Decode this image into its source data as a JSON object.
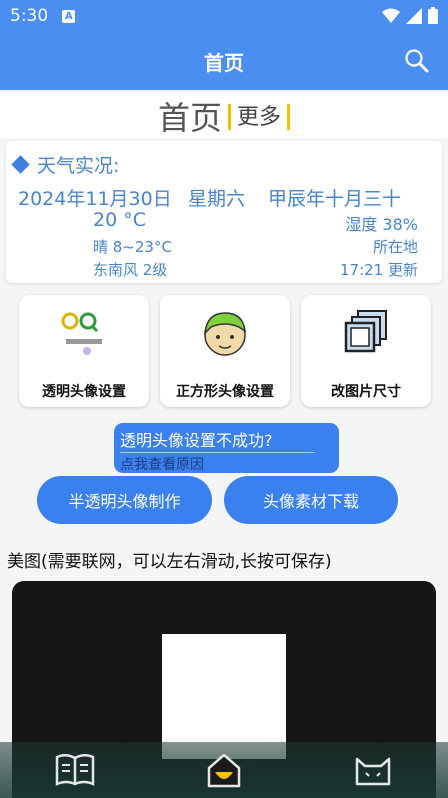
{
  "status_bar": {
    "time": "5:30",
    "app_badge": "A"
  },
  "app_bar": {
    "title": "首页",
    "search_icon": "search-icon"
  },
  "tabs": {
    "home": "首页",
    "more": "更多"
  },
  "weather": {
    "title": "天气实况:",
    "date": "2024年11月30日",
    "weekday": "星期六",
    "lunar": "甲辰年十月三十",
    "temperature": "20 °C",
    "humidity": "湿度 38%",
    "condition": "晴 8~23°C",
    "location": "所在地",
    "wind": "东南风 2级",
    "updated": "17:21 更新"
  },
  "tools": [
    {
      "label": "透明头像设置",
      "icon": "qq-transparent-avatar-icon"
    },
    {
      "label": "正方形头像设置",
      "icon": "square-avatar-icon"
    },
    {
      "label": "改图片尺寸",
      "icon": "resize-image-icon"
    }
  ],
  "help": {
    "question": "透明头像设置不成功?",
    "link": "点我查看原因"
  },
  "buttons": {
    "translucent": "半透明头像制作",
    "materials": "头像素材下载"
  },
  "gallery": {
    "caption": "美图(需要联网，可以左右滑动,长按可保存)"
  },
  "nav": [
    {
      "icon": "book-icon"
    },
    {
      "icon": "home-icon"
    },
    {
      "icon": "cat-icon"
    }
  ],
  "colors": {
    "primary": "#4a8ef2",
    "accent": "#3b80ef",
    "weather_text": "#4a84c8"
  }
}
